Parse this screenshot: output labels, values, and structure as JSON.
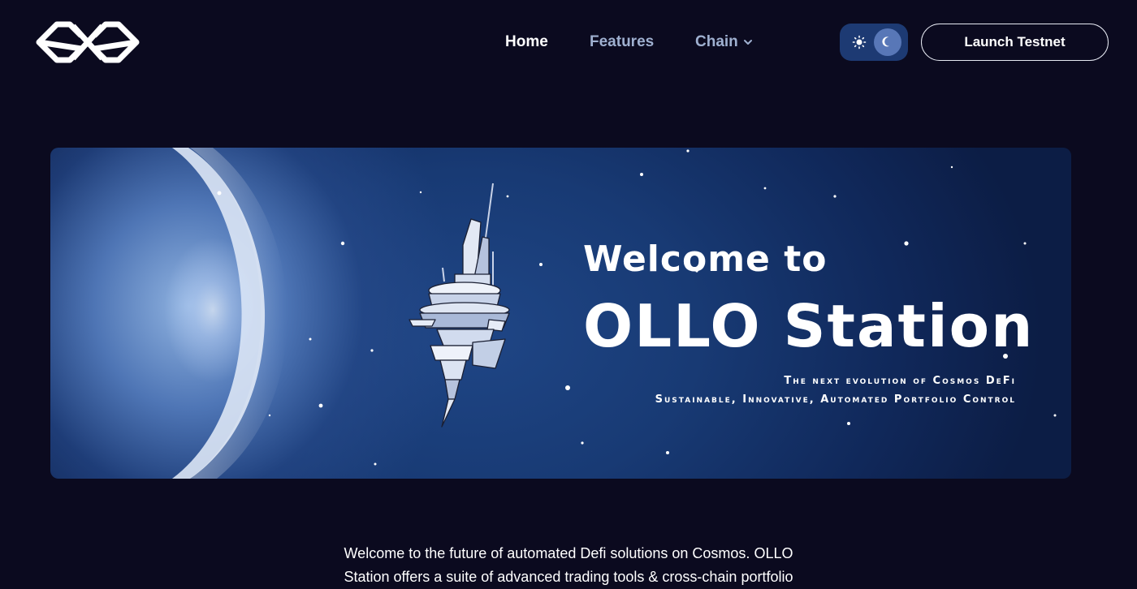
{
  "brand": {
    "logo_name": "OXO",
    "logo_icon": "oxo-logo"
  },
  "nav": {
    "items": [
      {
        "label": "Home",
        "active": true
      },
      {
        "label": "Features",
        "active": false
      },
      {
        "label": "Chain",
        "active": false,
        "dropdown": true
      }
    ]
  },
  "theme_toggle": {
    "light_icon": "sun-icon",
    "dark_icon": "moon-icon",
    "selected": "dark"
  },
  "launch_button": {
    "label": "Launch Testnet"
  },
  "hero": {
    "title_line_1": "Welcome to",
    "title_line_2": "OLLO Station",
    "subtitle_line_1": "The next evolution of Cosmos DeFi",
    "subtitle_line_2": "Sustainable, Innovative, Automated Portfolio Control"
  },
  "intro": {
    "line_1": "Welcome to the future of automated Defi solutions on Cosmos. OLLO",
    "line_2": "Station offers a suite of advanced trading tools & cross-chain portfolio"
  },
  "colors": {
    "background": "#0b0a1f",
    "nav_inactive": "#9fb0d0",
    "toggle_bg": "#1d3a73",
    "toggle_knob": "#5877b7",
    "hero_blue": "#183a74"
  }
}
